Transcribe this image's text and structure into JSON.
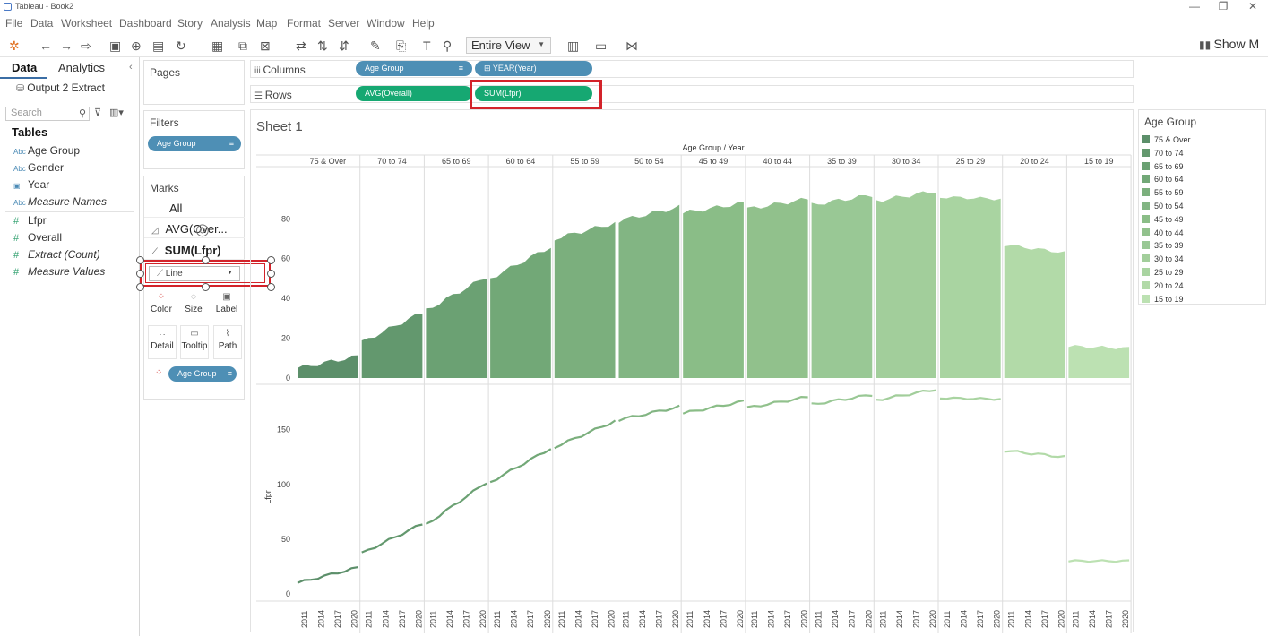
{
  "app": {
    "title": "Tableau - Book2"
  },
  "window": {
    "minimize": "—",
    "restore": "❐",
    "close": "✕"
  },
  "menu": [
    "File",
    "Data",
    "Worksheet",
    "Dashboard",
    "Story",
    "Analysis",
    "Map",
    "Format",
    "Server",
    "Window",
    "Help"
  ],
  "toolbar": {
    "fit_label": "Entire View",
    "show_me": "Show M"
  },
  "left": {
    "tab_data": "Data",
    "tab_analytics": "Analytics",
    "datasource": "Output 2 Extract",
    "search_placeholder": "Search",
    "tables_heading": "Tables",
    "fields": [
      {
        "icon": "Abc",
        "name": "Age Group",
        "italic": false
      },
      {
        "icon": "Abc",
        "name": "Gender",
        "italic": false
      },
      {
        "icon": "▣",
        "name": "Year",
        "italic": false
      },
      {
        "icon": "Abc",
        "name": "Measure Names",
        "italic": true
      },
      {
        "icon": "#",
        "name": "Lfpr",
        "italic": false
      },
      {
        "icon": "#",
        "name": "Overall",
        "italic": false
      },
      {
        "icon": "#",
        "name": "Extract (Count)",
        "italic": true
      },
      {
        "icon": "#",
        "name": "Measure Values",
        "italic": true
      }
    ]
  },
  "pages": {
    "title": "Pages"
  },
  "filters": {
    "title": "Filters",
    "pill": "Age Group"
  },
  "marks": {
    "title": "Marks",
    "all": "All",
    "avg": "AVG(Over...",
    "sum": "SUM(Lfpr)",
    "type": "Line",
    "buttons": [
      "Color",
      "Size",
      "Label",
      "Detail",
      "Tooltip",
      "Path"
    ],
    "color_pill": "Age Group"
  },
  "shelves": {
    "columns_label": "Columns",
    "rows_label": "Rows",
    "columns": [
      "Age Group",
      "⊞ YEAR(Year)"
    ],
    "rows": [
      "AVG(Overall)",
      "SUM(Lfpr)"
    ]
  },
  "sheet": {
    "title": "Sheet 1",
    "header": "Age Group / Year"
  },
  "legend": {
    "title": "Age Group",
    "items": [
      "75 & Over",
      "70 to 74",
      "65 to 69",
      "60 to 64",
      "55 to 59",
      "50 to 54",
      "45 to 49",
      "40 to 44",
      "35 to 39",
      "30 to 34",
      "25 to 29",
      "20 to 24",
      "15 to 19"
    ],
    "colors": [
      "#5c8f6a",
      "#63986e",
      "#6ba173",
      "#72a877",
      "#7baf7d",
      "#82b583",
      "#8abd87",
      "#91c18c",
      "#99c895",
      "#a2ce9b",
      "#a9d4a1",
      "#b2daa8",
      "#bce1b2"
    ]
  },
  "chart_data": {
    "type": "area",
    "categories": [
      "75 & Over",
      "70 to 74",
      "65 to 69",
      "60 to 64",
      "55 to 59",
      "50 to 54",
      "45 to 49",
      "40 to 44",
      "35 to 39",
      "30 to 34",
      "25 to 29",
      "20 to 24",
      "15 to 19"
    ],
    "x_labels": [
      "2011",
      "2014",
      "2017",
      "2020"
    ],
    "top_pane": {
      "measure": "AVG(Overall)",
      "yticks": [
        0,
        20,
        40,
        60,
        80
      ],
      "ylim": [
        0,
        95
      ],
      "series": [
        {
          "name": "75 & Over",
          "start": 5,
          "end": 11
        },
        {
          "name": "70 to 74",
          "start": 18,
          "end": 33
        },
        {
          "name": "65 to 69",
          "start": 34,
          "end": 51
        },
        {
          "name": "60 to 64",
          "start": 50,
          "end": 66
        },
        {
          "name": "55 to 59",
          "start": 70,
          "end": 78
        },
        {
          "name": "50 to 54",
          "start": 79,
          "end": 86
        },
        {
          "name": "45 to 49",
          "start": 83,
          "end": 88
        },
        {
          "name": "40 to 44",
          "start": 85,
          "end": 90
        },
        {
          "name": "35 to 39",
          "start": 87,
          "end": 92
        },
        {
          "name": "30 to 34",
          "start": 89,
          "end": 94
        },
        {
          "name": "25 to 29",
          "start": 91,
          "end": 90
        },
        {
          "name": "20 to 24",
          "start": 67,
          "end": 63
        },
        {
          "name": "15 to 19",
          "start": 16,
          "end": 15
        }
      ]
    },
    "bottom_pane": {
      "measure": "SUM(Lfpr)",
      "ylabel": "Lfpr",
      "yticks": [
        0,
        50,
        100,
        150
      ],
      "ylim": [
        -5,
        185
      ],
      "series": [
        {
          "name": "75 & Over",
          "start": 10,
          "end": 24
        },
        {
          "name": "70 to 74",
          "start": 37,
          "end": 64
        },
        {
          "name": "65 to 69",
          "start": 63,
          "end": 102
        },
        {
          "name": "60 to 64",
          "start": 102,
          "end": 133
        },
        {
          "name": "55 to 59",
          "start": 134,
          "end": 158
        },
        {
          "name": "50 to 54",
          "start": 159,
          "end": 171
        },
        {
          "name": "45 to 49",
          "start": 165,
          "end": 176
        },
        {
          "name": "40 to 44",
          "start": 170,
          "end": 180
        },
        {
          "name": "35 to 39",
          "start": 173,
          "end": 182
        },
        {
          "name": "30 to 34",
          "start": 177,
          "end": 187
        },
        {
          "name": "25 to 29",
          "start": 179,
          "end": 178
        },
        {
          "name": "20 to 24",
          "start": 131,
          "end": 125
        },
        {
          "name": "15 to 19",
          "start": 30,
          "end": 30
        }
      ]
    }
  }
}
